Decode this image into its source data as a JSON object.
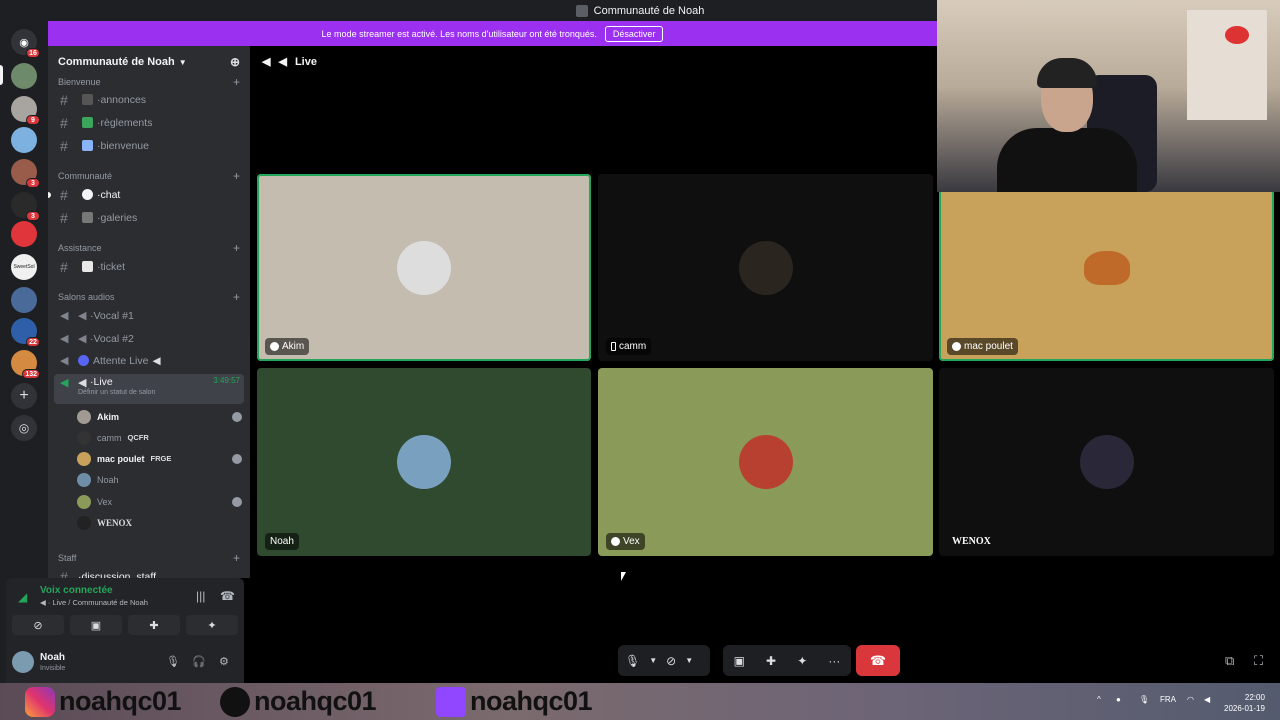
{
  "window": {
    "title": "Communauté de Noah"
  },
  "streamer_banner": {
    "text": "Le mode streamer est activé. Les noms d'utilisateur ont été tronqués.",
    "button": "Désactiver"
  },
  "servers": [
    {
      "name": "dm-icon",
      "badge": "16"
    },
    {
      "name": "server-1",
      "badge": ""
    },
    {
      "name": "server-2",
      "badge": "9"
    },
    {
      "name": "server-3",
      "badge": ""
    },
    {
      "name": "server-4",
      "badge": "3"
    },
    {
      "name": "server-5",
      "badge": "3"
    },
    {
      "name": "server-6",
      "badge": ""
    },
    {
      "name": "server-7",
      "label": "SweetSol",
      "badge": ""
    },
    {
      "name": "server-8",
      "badge": ""
    },
    {
      "name": "server-9",
      "badge": "22"
    },
    {
      "name": "server-10",
      "badge": "132"
    }
  ],
  "guild": {
    "name": "Communauté de Noah"
  },
  "categories": {
    "bienvenue": "Bienvenue",
    "communaute": "Communauté",
    "assistance": "Assistance",
    "salons_audio": "Salons audios",
    "staff": "Staff"
  },
  "channels": {
    "annonces": "annonces",
    "reglements": "règlements",
    "bienvenue": "bienvenue",
    "chat": "chat",
    "galeries": "galeries",
    "ticket": "ticket",
    "vocal1": "Vocal #1",
    "vocal2": "Vocal #2",
    "attente": "Attente Live",
    "live": "Live",
    "live_time": "3:49:57",
    "live_status": "Définir un statut de salon",
    "discussion": "discussion_staff"
  },
  "voice_members": [
    {
      "name": "Akim",
      "tag": ""
    },
    {
      "name": "camm",
      "tag": "QCFR"
    },
    {
      "name": "mac poulet",
      "tag": "FRGE"
    },
    {
      "name": "Noah",
      "tag": ""
    },
    {
      "name": "Vex",
      "tag": ""
    },
    {
      "name": "WENOX",
      "tag": ""
    }
  ],
  "voice_panel": {
    "status": "Voix connectée",
    "location": "Live / Communauté de Noah"
  },
  "user_panel": {
    "name": "Noah",
    "status": "Invisible"
  },
  "stage": {
    "channel": "Live"
  },
  "tiles": [
    {
      "name": "Akim",
      "bg": "#c5bcb0",
      "icon": "xbox-icon"
    },
    {
      "name": "camm",
      "bg": "#0f0f0f",
      "icon": "phone-icon"
    },
    {
      "name": "mac poulet",
      "bg": "#c8a25a",
      "icon": "xbox-icon"
    },
    {
      "name": "Noah",
      "bg": "#2f4a2f",
      "icon": ""
    },
    {
      "name": "Vex",
      "bg": "#8a9a58",
      "icon": "xbox-icon"
    },
    {
      "name": "WENOX",
      "bg": "#0f0f0f",
      "icon": ""
    }
  ],
  "taskbar": {
    "handles": [
      "noahqc01",
      "noahqc01",
      "noahqc01"
    ],
    "lang": "FRA",
    "time": "22:00",
    "date": "2026-01-19"
  }
}
